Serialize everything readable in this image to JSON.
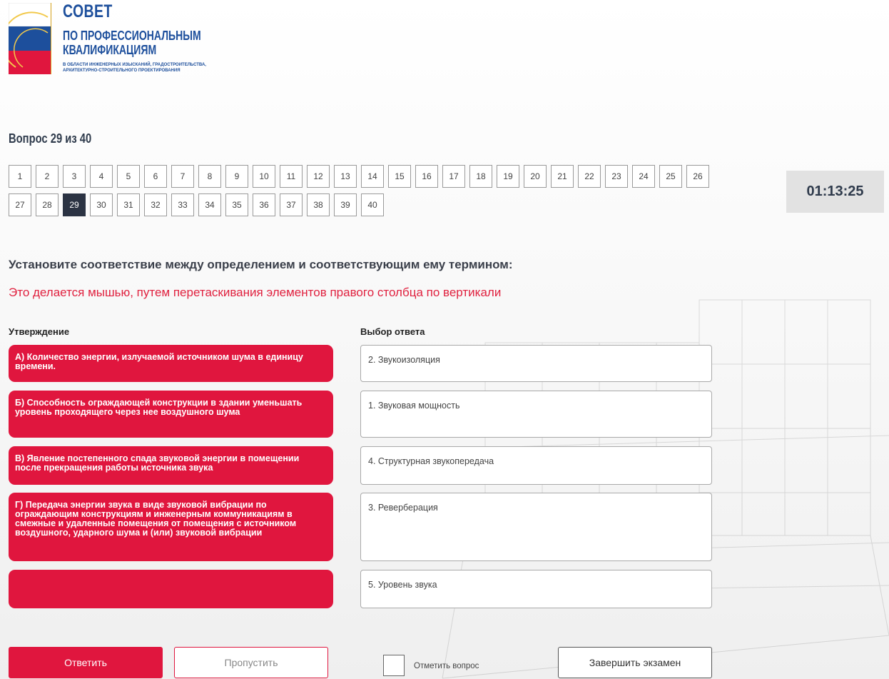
{
  "logo": {
    "title": "СОВЕТ",
    "line1": "ПО ПРОФЕССИОНАЛЬНЫМ",
    "line2": "КВАЛИФИКАЦИЯМ",
    "small1": "В ОБЛАСТИ ИНЖЕНЕРНЫХ ИЗЫСКАНИЙ, ГРАДОСТРОИТЕЛЬСТВА,",
    "small2": "АРХИТЕКТУРНО-СТРОИТЕЛЬНОГО ПРОЕКТИРОВАНИЯ",
    "colors": {
      "blue": "#1d4f9c",
      "red": "#e0163e",
      "white": "#ffffff"
    }
  },
  "question_header": "Вопрос 29 из 40",
  "question_nav": {
    "numbers": [
      "1",
      "2",
      "3",
      "4",
      "5",
      "6",
      "7",
      "8",
      "9",
      "10",
      "11",
      "12",
      "13",
      "14",
      "15",
      "16",
      "17",
      "18",
      "19",
      "20",
      "21",
      "22",
      "23",
      "24",
      "25",
      "26",
      "27",
      "28",
      "29",
      "30",
      "31",
      "32",
      "33",
      "34",
      "35",
      "36",
      "37",
      "38",
      "39",
      "40"
    ],
    "current": "29"
  },
  "timer": "01:13:25",
  "instruction": "Установите соответствие между определением и соответствующим ему термином:",
  "hint": "Это делается мышью, путем перетаскивания элементов правого столбца по вертикали",
  "columns": {
    "left_header": "Утверждение",
    "right_header": "Выбор ответа"
  },
  "statements": [
    "А) Количество энергии, излучаемой источником шума в единицу времени.",
    "Б) Способность ограждающей конструкции в здании уменьшать уровень проходящего через нее воздушного шума",
    "В) Явление постепенного спада звуковой энергии в помещении после прекращения работы источника звука",
    "Г) Передача энергии звука в виде звуковой вибрации по ограждающим конструкциям и инженерным коммуникациям в смежные и удаленные помещения от помещения с источником воздушного, ударного шума и (или) звуковой вибрации",
    ""
  ],
  "answers": [
    "2. Звукоизоляция",
    "1. Звуковая мощность",
    "4. Структурная звукопередача",
    "3. Реверберация",
    "5. Уровень звука"
  ],
  "buttons": {
    "answer": "Ответить",
    "skip": "Пропустить",
    "flag": "Отметить вопрос",
    "finish": "Завершить экзамен"
  },
  "colors": {
    "accent": "#e0163e",
    "active_question": "#2b3343",
    "timer_bg": "#e2e2e2"
  }
}
